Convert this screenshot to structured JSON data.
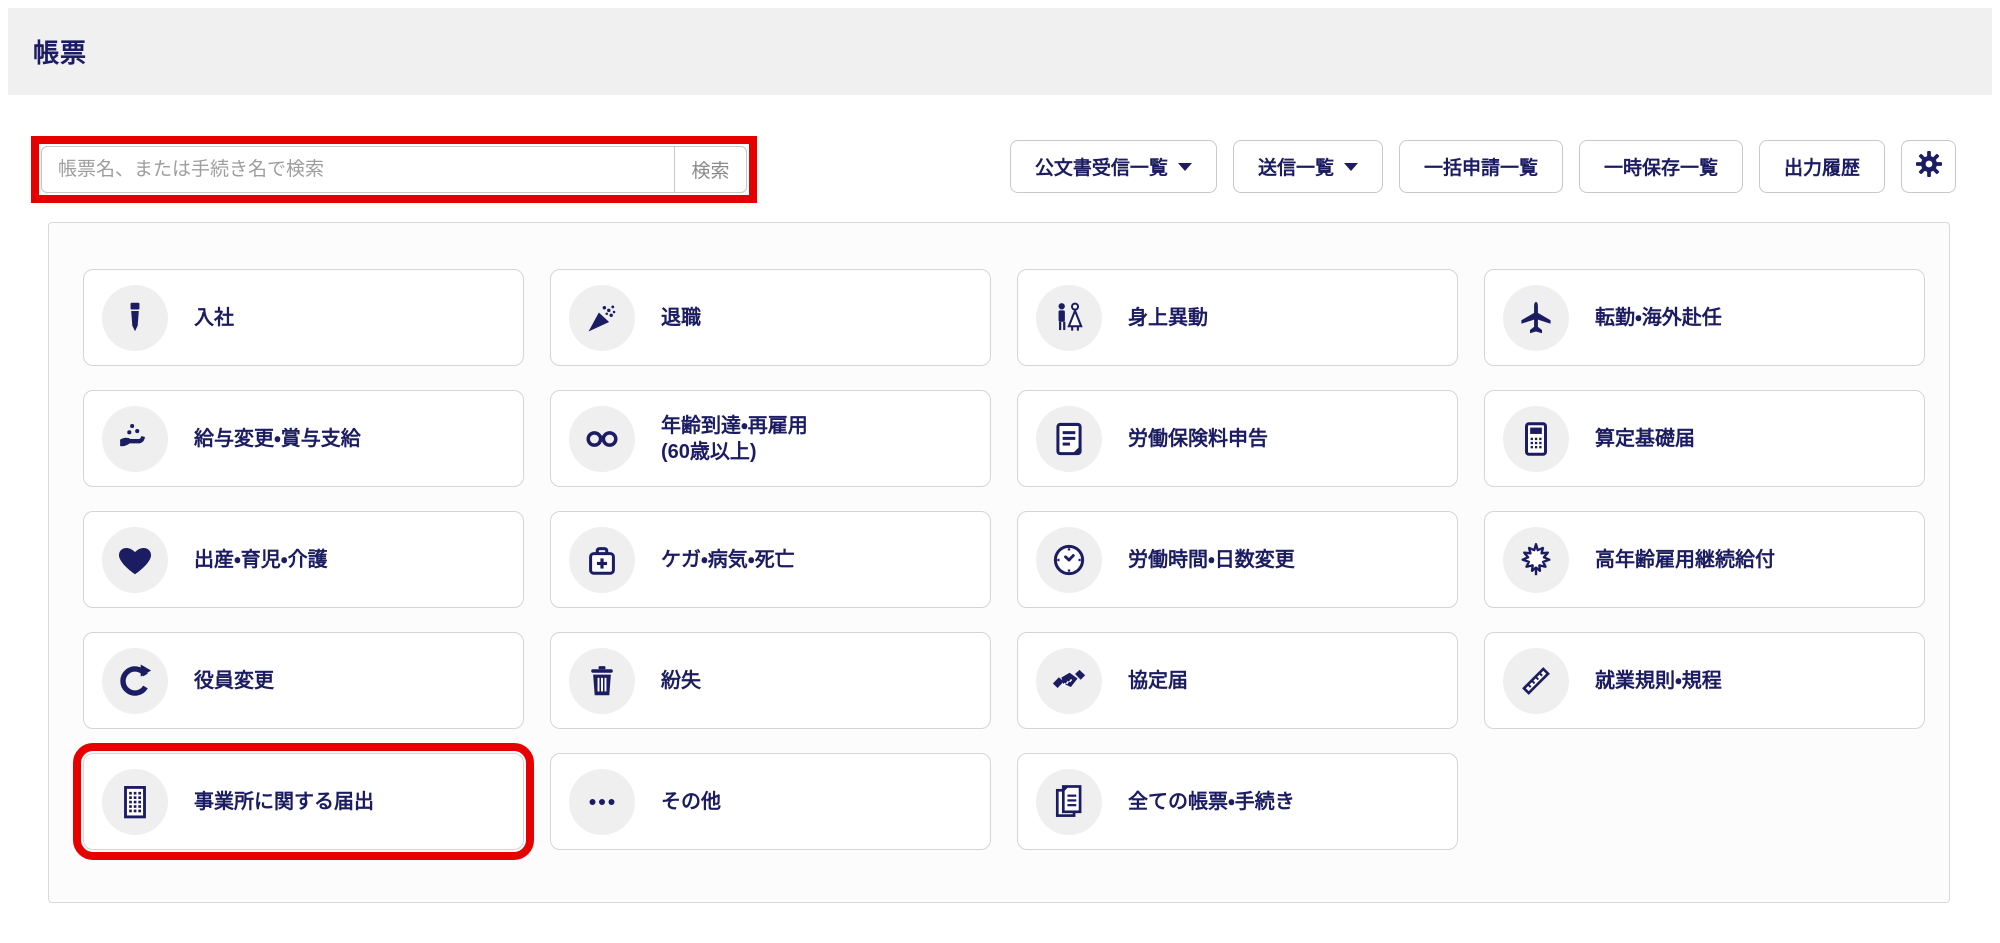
{
  "page": {
    "title": "帳票"
  },
  "search": {
    "placeholder": "帳票名、または手続き名で検索",
    "button_label": "検索"
  },
  "toolbar": {
    "buttons": [
      {
        "label": "公文書受信一覧",
        "has_caret": true
      },
      {
        "label": "送信一覧",
        "has_caret": true
      },
      {
        "label": "一括申請一覧",
        "has_caret": false
      },
      {
        "label": "一時保存一覧",
        "has_caret": false
      },
      {
        "label": "出力履歴",
        "has_caret": false
      }
    ],
    "settings_icon": "gear-icon"
  },
  "categories": [
    {
      "label": "入社",
      "icon": "necktie-icon"
    },
    {
      "label": "退職",
      "icon": "party-popper-icon"
    },
    {
      "label": "身上異動",
      "icon": "wedding-couple-icon"
    },
    {
      "label": "転勤・海外赴任",
      "icon": "airplane-icon"
    },
    {
      "label": "給与変更・賞与支給",
      "icon": "salary-hand-icon"
    },
    {
      "label": "年齢到達・再雇用",
      "sublabel": "(60歳以上)",
      "icon": "glasses-icon"
    },
    {
      "label": "労働保険料申告",
      "icon": "document-icon"
    },
    {
      "label": "算定基礎届",
      "icon": "calculator-icon"
    },
    {
      "label": "出産・育児・介護",
      "icon": "heart-icon"
    },
    {
      "label": "ケガ・病気・死亡",
      "icon": "first-aid-icon"
    },
    {
      "label": "労働時間・日数変更",
      "icon": "clock-icon"
    },
    {
      "label": "高年齢雇用継続給付",
      "icon": "maple-leaf-icon"
    },
    {
      "label": "役員変更",
      "icon": "refresh-icon"
    },
    {
      "label": "紛失",
      "icon": "trash-icon"
    },
    {
      "label": "協定届",
      "icon": "handshake-icon"
    },
    {
      "label": "就業規則・規程",
      "icon": "ruler-icon"
    },
    {
      "label": "事業所に関する届出",
      "icon": "building-icon",
      "highlighted": true
    },
    {
      "label": "その他",
      "icon": "ellipsis-icon"
    },
    {
      "label": "全ての帳票・手続き",
      "icon": "documents-icon"
    }
  ],
  "annotations": {
    "highlight_color": "#e60000",
    "highlighted_regions": [
      "search-bar",
      "category-card-事業所に関する届出"
    ]
  },
  "colors": {
    "accent_navy": "#1c1c63",
    "header_bg": "#f0f0f0",
    "icon_circle_bg": "#efefef",
    "card_border": "#d5d5d5"
  }
}
